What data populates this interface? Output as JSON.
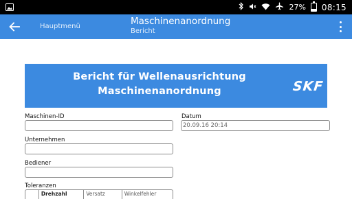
{
  "status_bar": {
    "battery": "27%",
    "battery_level": 0.27,
    "time": "08:15",
    "icons": [
      "image-icon",
      "bluetooth-icon",
      "mute-icon",
      "wifi-icon",
      "airplane-icon",
      "battery-icon"
    ]
  },
  "app_bar": {
    "nav_label": "Hauptmenü",
    "title": "Maschinenanordnung",
    "subtitle": "Bericht",
    "color": "#3c8ae0"
  },
  "banner": {
    "line1": "Bericht für Wellenausrichtung",
    "line2": "Maschinenanordnung",
    "logo": "SKF"
  },
  "form": {
    "machine_id": {
      "label": "Maschinen-ID",
      "value": ""
    },
    "date": {
      "label": "Datum",
      "value": "20.09.16 20:14"
    },
    "company": {
      "label": "Unternehmen",
      "value": ""
    },
    "operator": {
      "label": "Bediener",
      "value": ""
    },
    "tolerances": {
      "label": "Toleranzen",
      "columns": [
        "",
        "Drehzahl",
        "Versatz",
        "Winkelfehler"
      ]
    }
  }
}
